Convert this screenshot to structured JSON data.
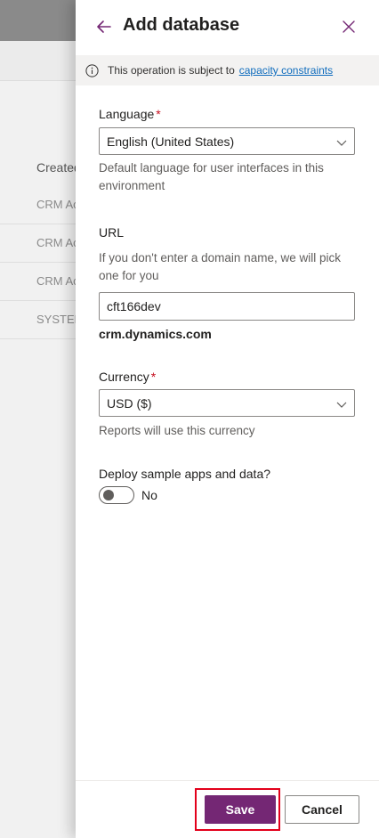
{
  "background": {
    "column_header": "Created",
    "rows": [
      "CRM Ac",
      "CRM Ac",
      "CRM Ac",
      "SYSTEM"
    ]
  },
  "panel": {
    "title": "Add database",
    "back_icon": "back-arrow-icon",
    "close_icon": "close-icon",
    "info": {
      "text": "This operation is subject to",
      "link": "capacity constraints"
    },
    "language": {
      "label": "Language",
      "required_mark": "*",
      "value": "English (United States)",
      "hint": "Default language for user interfaces in this environment"
    },
    "url": {
      "label": "URL",
      "hint": "If you don't enter a domain name, we will pick one for you",
      "value": "cft166dev",
      "suffix": "crm.dynamics.com"
    },
    "currency": {
      "label": "Currency",
      "required_mark": "*",
      "value": "USD ($)",
      "hint": "Reports will use this currency"
    },
    "sample": {
      "label": "Deploy sample apps and data?",
      "toggle_state": "No"
    },
    "footer": {
      "save_label": "Save",
      "cancel_label": "Cancel"
    }
  },
  "colors": {
    "accent": "#742774",
    "link": "#0f6cbd",
    "highlight": "#e3001b",
    "required": "#c50f1f"
  }
}
